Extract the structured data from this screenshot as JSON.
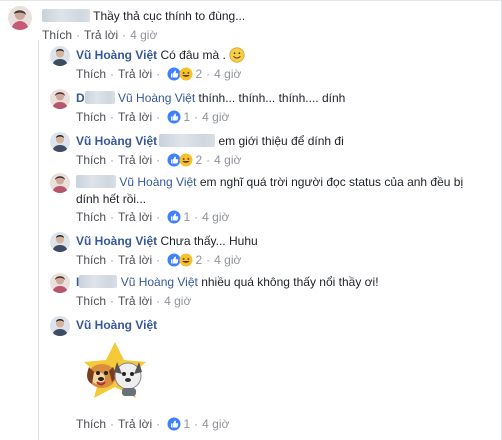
{
  "comments": [
    {
      "kind": "top",
      "name_prefix": "",
      "text": "Thầy thả cục thính to đùng...",
      "actions": {
        "like": "Thích",
        "reply": "Trả lời",
        "reactions": "",
        "time": "4 giờ"
      }
    },
    {
      "kind": "reply",
      "author": "Vũ Hoàng Việt",
      "text": "Có đâu mà .",
      "emoji": "smile-emoji",
      "actions": {
        "like": "Thích",
        "reply": "Trả lời",
        "reactions": "2",
        "reaction_types": [
          "like",
          "haha"
        ],
        "time": "4 giờ"
      }
    },
    {
      "kind": "reply",
      "name_prefix": "D",
      "mention": "Vũ Hoàng Việt",
      "text": "thính... thính... thính.... dính",
      "actions": {
        "like": "Thích",
        "reply": "Trả lời",
        "reactions": "1",
        "reaction_types": [
          "like"
        ],
        "time": "4 giờ"
      }
    },
    {
      "kind": "reply",
      "author": "Vũ Hoàng Việt",
      "text": "em giới thiệu để dính đi",
      "actions": {
        "like": "Thích",
        "reply": "Trả lời",
        "reactions": "2",
        "reaction_types": [
          "like",
          "haha"
        ],
        "time": "4 giờ"
      }
    },
    {
      "kind": "reply",
      "mention": "Vũ Hoàng Việt",
      "text": "em nghĩ quá trời người đọc status của anh đều bị",
      "text_line2": "dính hết rồi...",
      "actions": {
        "like": "Thích",
        "reply": "Trả lời",
        "reactions": "1",
        "reaction_types": [
          "like"
        ],
        "time": "4 giờ"
      }
    },
    {
      "kind": "reply",
      "author": "Vũ Hoàng Việt",
      "text": "Chưa thấy... Huhu",
      "actions": {
        "like": "Thích",
        "reply": "Trả lời",
        "reactions": "2",
        "reaction_types": [
          "like",
          "haha"
        ],
        "time": "4 giờ"
      }
    },
    {
      "kind": "reply",
      "name_prefix": "I",
      "mention": "Vũ Hoàng Việt",
      "text": "nhiều quá không thấy nổi thầy ơi!",
      "actions": {
        "like": "Thích",
        "reply": "Trả lời",
        "reactions": "",
        "time": "4 giờ"
      }
    },
    {
      "kind": "reply",
      "author": "Vũ Hoàng Việt",
      "text": "",
      "sticker": "cartoon-dogs-sticker",
      "actions": {
        "like": "Thích",
        "reply": "Trả lời",
        "reactions": "1",
        "reaction_types": [
          "like"
        ],
        "time": "4 giờ"
      }
    }
  ],
  "ui": {
    "separator": "·"
  },
  "colors": {
    "link": "#365899",
    "meta": "#90949c",
    "like_blue": "#4080ff",
    "haha_yellow": "#f7c12b"
  }
}
